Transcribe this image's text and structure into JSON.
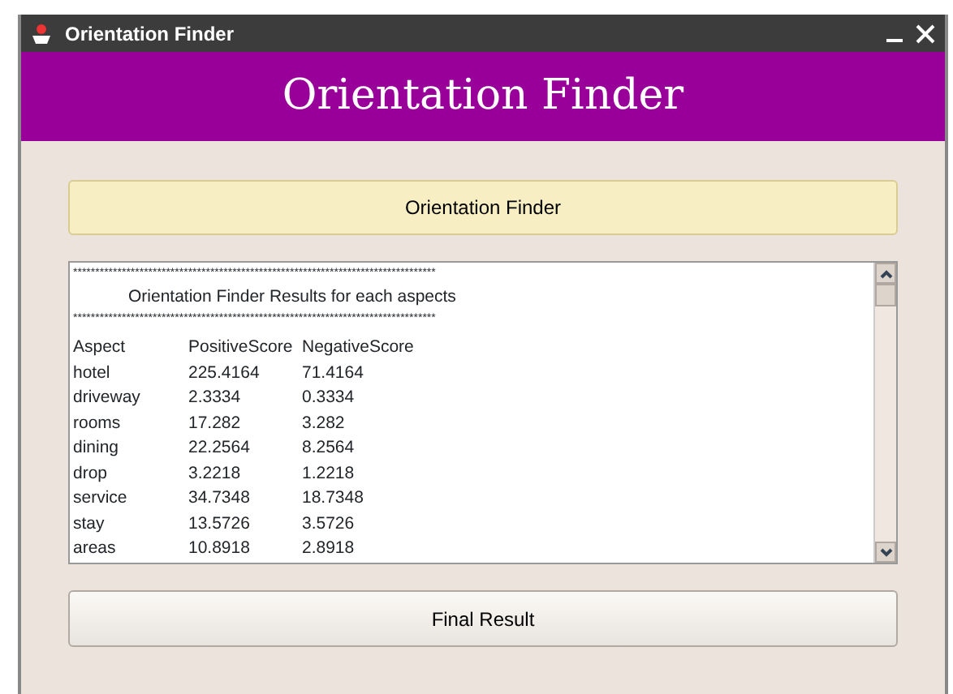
{
  "window": {
    "title": "Orientation Finder"
  },
  "banner": {
    "title": "Orientation Finder"
  },
  "top_button": "Orientation Finder",
  "results": {
    "separator_top": "**********************************************************************************",
    "heading": "Orientation Finder Results for each aspects",
    "separator_bottom": "**********************************************************************************",
    "columns": [
      "Aspect",
      "PositiveScore",
      "NegativeScore"
    ],
    "rows": [
      [
        "hotel",
        "225.4164",
        "71.4164"
      ],
      [
        "driveway",
        "2.3334",
        "0.3334"
      ],
      [
        "rooms",
        "17.282",
        "3.282"
      ],
      [
        "dining",
        "22.2564",
        "8.2564"
      ],
      [
        "drop",
        "3.2218",
        "1.2218"
      ],
      [
        "service",
        "34.7348",
        "18.7348"
      ],
      [
        "stay",
        "13.5726",
        "3.5726"
      ],
      [
        "areas",
        "10.8918",
        "2.8918"
      ]
    ]
  },
  "bottom_button": "Final Result"
}
